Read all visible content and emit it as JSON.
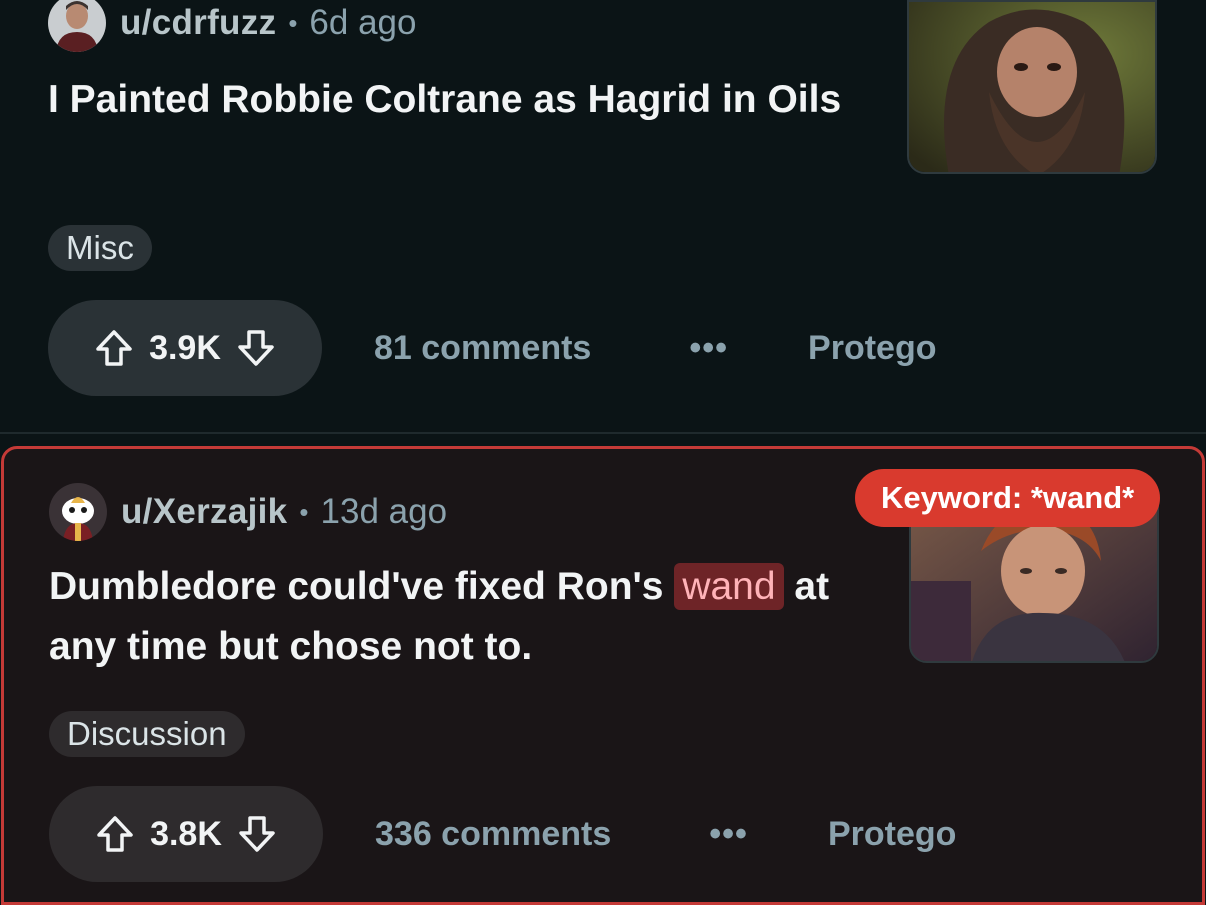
{
  "posts": [
    {
      "author": "u/cdrfuzz",
      "separator": "•",
      "age": "6d ago",
      "title": "I Painted Robbie Coltrane as Hagrid in Oils",
      "flair": "Misc",
      "score": "3.9K",
      "comments": "81 comments",
      "more": "•••",
      "tag": "Protego",
      "avatar_icon": "user-avatar-icon",
      "thumbnail": "hagrid-portrait-thumbnail"
    },
    {
      "author": "u/Xerzajik",
      "separator": "•",
      "age": "13d ago",
      "title_before": "Dumbledore could've fixed Ron's ",
      "title_keyword": "wand",
      "title_after": " at any time but chose not to.",
      "flair": "Discussion",
      "score": "3.8K",
      "comments": "336 comments",
      "more": "•••",
      "tag": "Protego",
      "keyword_badge": "Keyword: *wand*",
      "avatar_icon": "snoo-avatar-icon",
      "thumbnail": "ron-scene-thumbnail"
    }
  ],
  "colors": {
    "background": "#0b1416",
    "highlight_border": "#c43a37",
    "badge": "#d93a2e",
    "keyword_bg": "#6e2427",
    "keyword_text": "#ffb3b8",
    "muted_text": "#8ba2ad"
  }
}
